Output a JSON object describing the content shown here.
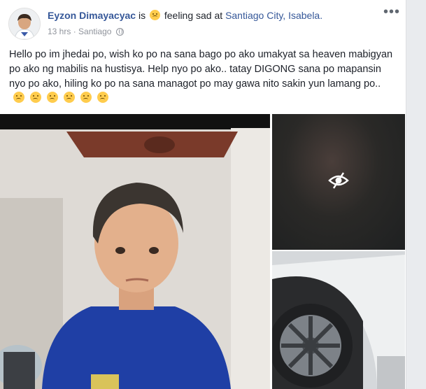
{
  "post": {
    "author": "Eyzon Dimayacyac",
    "is_text": "is",
    "feeling_text": "feeling sad at",
    "location": "Santiago City, Isabela.",
    "time": "13 hrs",
    "separator": "·",
    "place": "Santiago",
    "more_label": "•••",
    "body": "Hello po im jhedai po, wish ko po na sana bago po ako umakyat sa heaven mabigyan po ako ng mabilis na hustisya. Help nyo po ako.. tatay DIGONG sana po mapansin nyo po ako, hiling ko po na sana managot po may gawa nito sakin yun lamang po..",
    "body_emojis": [
      "sad-emoji",
      "sad-emoji",
      "sad-emoji",
      "crying-emoji",
      "crying-emoji",
      "crying-emoji"
    ],
    "feeling_icon": "sad-emoji",
    "privacy_icon": "globe-icon"
  },
  "photos": [
    {
      "name": "photo-child",
      "description_icon": "photo"
    },
    {
      "name": "photo-hidden",
      "overlay_icon": "eye-off-icon"
    },
    {
      "name": "photo-car-wheel",
      "description_icon": "photo"
    }
  ],
  "colors": {
    "link": "#365899",
    "text": "#1d2129",
    "muted": "#90949c",
    "background": "#e9ebee"
  }
}
